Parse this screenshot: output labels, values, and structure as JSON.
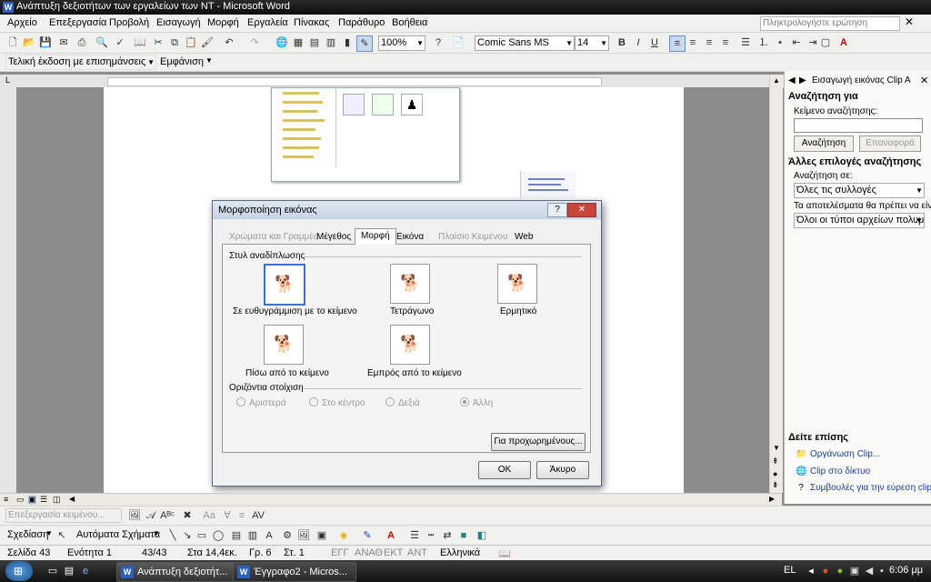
{
  "window": {
    "title": "Ανάπτυξη δεξιοτήτων των εργαλείων των  NT - Microsoft Word"
  },
  "menu": {
    "items": [
      "Αρχείο",
      "Επεξεργασία",
      "Προβολή",
      "Εισαγωγή",
      "Μορφή",
      "Εργαλεία",
      "Πίνακας",
      "Παράθυρο",
      "Βοήθεια"
    ],
    "ask_placeholder": "Πληκτρολογήστε ερώτηση"
  },
  "format_toolbar": {
    "zoom": "100%",
    "font": "Comic Sans MS",
    "size": "14"
  },
  "review_toolbar": {
    "view": "Τελική έκδοση με επισημάνσεις",
    "show": "Εμφάνιση"
  },
  "taskpane": {
    "title": "Εισαγωγή εικόνας Clip A",
    "search_heading": "Αναζήτηση για",
    "search_text_label": "Κείμενο αναζήτησης:",
    "search_value": "",
    "search_button": "Αναζήτηση",
    "restore_button": "Επαναφορά",
    "other_options": "Άλλες επιλογές αναζήτησης",
    "search_in_label": "Αναζήτηση σε:",
    "search_in_value": "Όλες τις συλλογές",
    "results_label": "Τα αποτελέσματα θα πρέπει να είναι:",
    "results_value": "Όλοι οι τύποι αρχείων πολυμέσω",
    "see_also": "Δείτε επίσης",
    "links": [
      "Οργάνωση Clip...",
      "Clip στο δίκτυο",
      "Συμβουλές για την εύρεση clip"
    ]
  },
  "dialog": {
    "title": "Μορφοποίηση εικόνας",
    "tabs": [
      "Χρώματα και Γραμμές",
      "Μέγεθος",
      "Μορφή",
      "Εικόνα",
      "Πλαίσιο Κειμένου",
      "Web"
    ],
    "active_tab": "Μορφή",
    "wrap_heading": "Στυλ αναδίπλωσης",
    "wrap_options": [
      "Σε ευθυγράμμιση με το κείμενο",
      "Τετράγωνο",
      "Ερμητικό",
      "Πίσω από το κείμενο",
      "Εμπρός από το κείμενο"
    ],
    "align_heading": "Οριζόντια στοίχιση",
    "align_options": [
      "Αριστερά",
      "Στο κέντρο",
      "Δεξιά",
      "Άλλη"
    ],
    "advanced_button": "Για προχωρημένους...",
    "ok_button": "OK",
    "cancel_button": "Άκυρο"
  },
  "picture_toolbar": {
    "edit_text": "Επεξεργασία κειμένου..."
  },
  "drawing_toolbar": {
    "draw": "Σχεδίαση",
    "autoshapes": "Αυτόματα Σχήματα"
  },
  "status": {
    "page": "Σελίδα 43",
    "section": "Ενότητα 1",
    "pages": "43/43",
    "at": "Στα 14,4εκ.",
    "line": "Γρ. 6",
    "col": "Στ. 1",
    "rec": "ΕΓΓ",
    "trk": "ΑΝΑΘ",
    "ext": "ΕΚΤ",
    "ovr": "ΑΝΤ",
    "lang": "Ελληνικά"
  },
  "taskbar": {
    "tasks": [
      "Ανάπτυξη δεξιοτήτ...",
      "Έγγραφο2 - Micros..."
    ],
    "lang": "EL",
    "time": "6:06 μμ"
  }
}
